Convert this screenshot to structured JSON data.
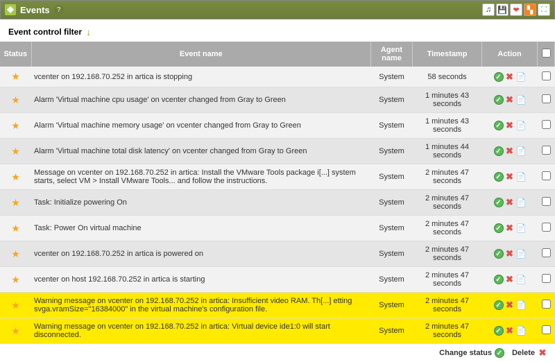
{
  "header": {
    "title": "Events"
  },
  "filter": {
    "title": "Event control filter"
  },
  "columns": {
    "status": "Status",
    "name": "Event name",
    "agent": "Agent name",
    "ts": "Timestamp",
    "action": "Action"
  },
  "rows": [
    {
      "name": "vcenter on 192.168.70.252 in artica is stopping",
      "agent": "System",
      "ts": "58 seconds",
      "warn": false
    },
    {
      "name": "Alarm 'Virtual machine cpu usage' on vcenter changed from Gray to Green",
      "agent": "System",
      "ts": "1 minutes 43 seconds",
      "warn": false
    },
    {
      "name": "Alarm 'Virtual machine memory usage' on vcenter changed from Gray to Green",
      "agent": "System",
      "ts": "1 minutes 43 seconds",
      "warn": false
    },
    {
      "name": "Alarm 'Virtual machine total disk latency' on vcenter changed from Gray to Green",
      "agent": "System",
      "ts": "1 minutes 44 seconds",
      "warn": false
    },
    {
      "name": "Message on vcenter on 192.168.70.252 in artica: Install the VMware Tools package i[...] system starts, select VM > Install VMware  Tools... and follow the instructions.",
      "agent": "System",
      "ts": "2 minutes 47 seconds",
      "warn": false
    },
    {
      "name": "Task: Initialize powering On",
      "agent": "System",
      "ts": "2 minutes 47 seconds",
      "warn": false
    },
    {
      "name": "Task: Power On virtual machine",
      "agent": "System",
      "ts": "2 minutes 47 seconds",
      "warn": false
    },
    {
      "name": "vcenter on 192.168.70.252 in artica is powered on",
      "agent": "System",
      "ts": "2 minutes 47 seconds",
      "warn": false
    },
    {
      "name": "vcenter on host 192.168.70.252 in artica is starting",
      "agent": "System",
      "ts": "2 minutes 47 seconds",
      "warn": false
    },
    {
      "name": "Warning message on vcenter on 192.168.70.252 in artica: Insufficient video RAM. Th[...] etting svga.vramSize=\"16384000\" in the virtual machine's configuration file.",
      "agent": "System",
      "ts": "2 minutes 47 seconds",
      "warn": true
    },
    {
      "name": "Warning message on vcenter on 192.168.70.252 in artica: Virtual device ide1:0 will start disconnected.",
      "agent": "System",
      "ts": "2 minutes 47 seconds",
      "warn": true
    }
  ],
  "footer": {
    "change": "Change status",
    "delete": "Delete"
  }
}
